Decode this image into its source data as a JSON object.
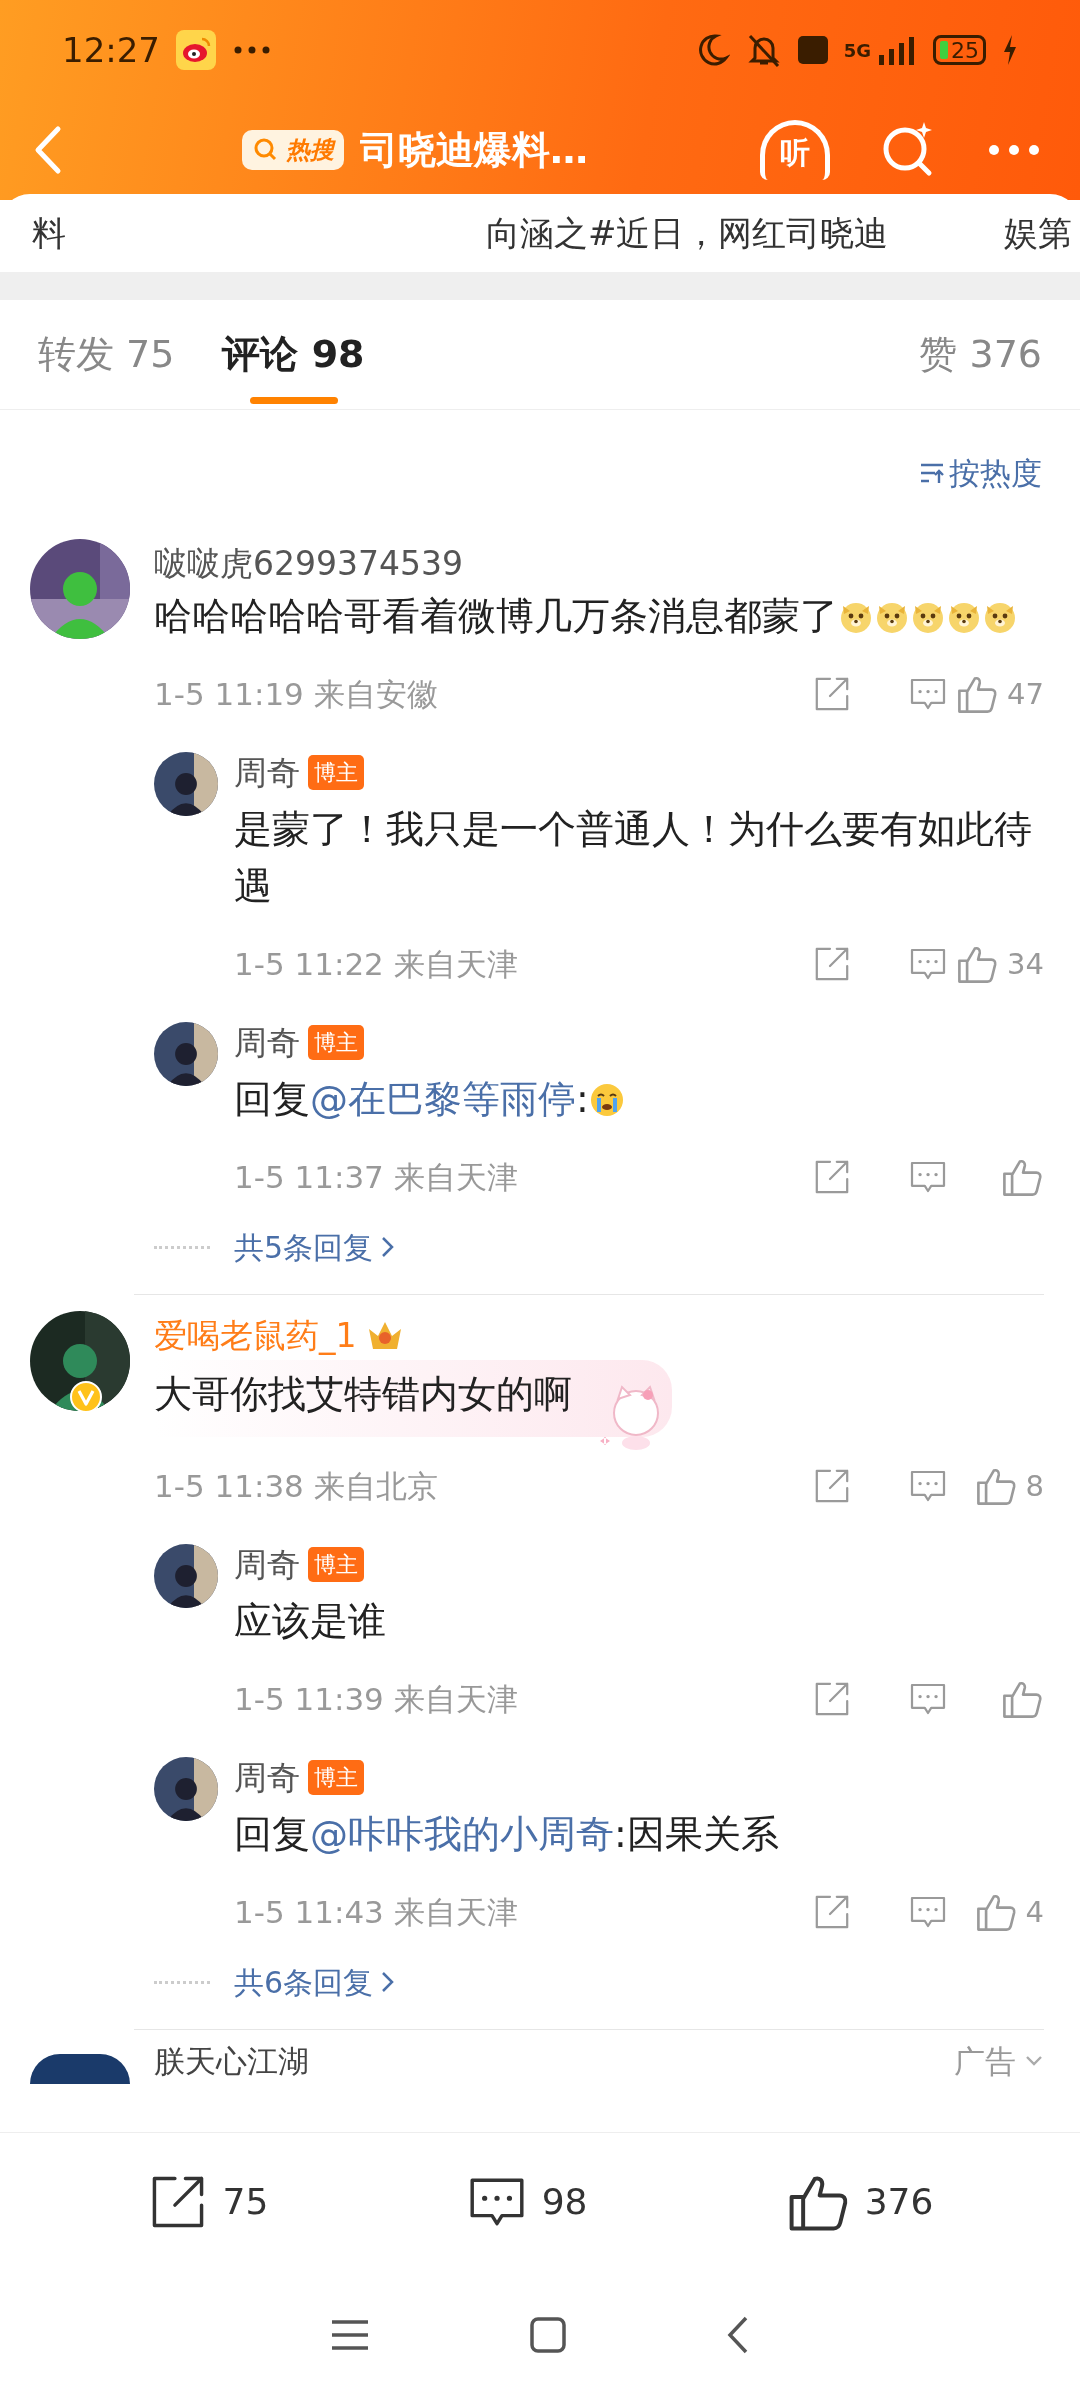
{
  "status_bar": {
    "time": "12:27",
    "network": "5G",
    "battery": "25"
  },
  "header": {
    "badge": "热搜",
    "title": "司晓迪爆料…",
    "listen_label": "听"
  },
  "ticker": [
    "料",
    "向涵之#近日，网红司晓迪",
    "娱第"
  ],
  "tabs": [
    {
      "label": "转发 75",
      "selected": false
    },
    {
      "label": "评论 98",
      "selected": true
    },
    {
      "label": "赞 376",
      "selected": false
    }
  ],
  "sort": "按热度",
  "comments": [
    {
      "user": "啵啵虎6299374539",
      "highlight_name": false,
      "crown": false,
      "verified": false,
      "decorated": false,
      "text": [
        {
          "kind": "text",
          "text": "哈哈哈哈哈哥看着微博几万条消息都蒙了"
        },
        {
          "kind": "emoji"
        },
        {
          "kind": "emoji"
        },
        {
          "kind": "emoji"
        },
        {
          "kind": "emoji"
        },
        {
          "kind": "emoji"
        }
      ],
      "time": "1-5 11:19",
      "location": "来自安徽",
      "likes": "47",
      "replies": [
        {
          "user": "周奇",
          "badge": "博主",
          "text": [
            {
              "kind": "text",
              "text": "是蒙了！我只是一个普通人！为什么要有如此待遇"
            }
          ],
          "time": "1-5 11:22",
          "location": "来自天津",
          "likes": "34"
        },
        {
          "user": "周奇",
          "badge": "博主",
          "text": [
            {
              "kind": "text",
              "text": "回复"
            },
            {
              "kind": "mention",
              "text": "@在巴黎等雨停"
            },
            {
              "kind": "text",
              "text": ":"
            },
            {
              "kind": "cry"
            }
          ],
          "time": "1-5 11:37",
          "location": "来自天津"
        }
      ],
      "more": "共5条回复"
    },
    {
      "user": "爱喝老鼠药_1",
      "highlight_name": true,
      "crown": true,
      "verified": true,
      "decorated": true,
      "text": [
        {
          "kind": "text",
          "text": "大哥你找艾特错内女的啊"
        }
      ],
      "time": "1-5 11:38",
      "location": "来自北京",
      "likes": "8",
      "replies": [
        {
          "user": "周奇",
          "badge": "博主",
          "text": [
            {
              "kind": "text",
              "text": "应该是谁"
            }
          ],
          "time": "1-5 11:39",
          "location": "来自天津"
        },
        {
          "user": "周奇",
          "badge": "博主",
          "text": [
            {
              "kind": "text",
              "text": "回复"
            },
            {
              "kind": "mention",
              "text": "@咔咔我的小周奇"
            },
            {
              "kind": "text",
              "text": ":因果关系"
            }
          ],
          "time": "1-5 11:43",
          "location": "来自天津",
          "likes": "4"
        }
      ],
      "more": "共6条回复"
    }
  ],
  "ad_row": {
    "user": "朕天心江湖",
    "label": "广告"
  },
  "bottom_bar": {
    "reposts": "75",
    "comments": "98",
    "likes": "376"
  }
}
